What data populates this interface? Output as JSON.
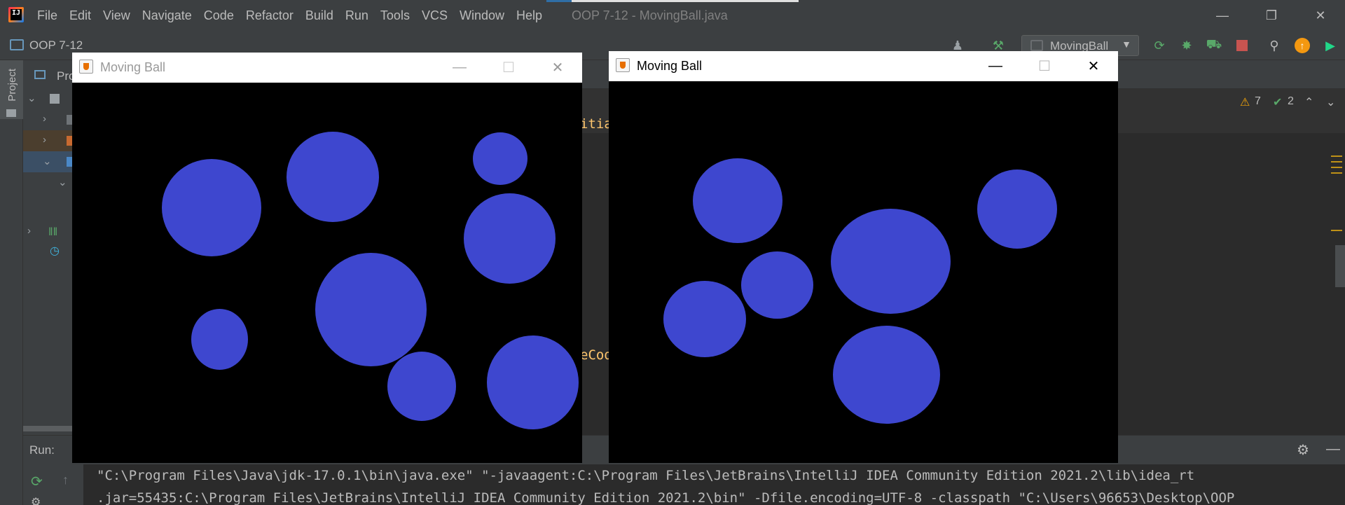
{
  "ide": {
    "menu": [
      "File",
      "Edit",
      "View",
      "Navigate",
      "Code",
      "Refactor",
      "Build",
      "Run",
      "Tools",
      "VCS",
      "Window",
      "Help"
    ],
    "window_title": "OOP 7-12 - MovingBall.java",
    "project_name": "OOP 7-12",
    "run_config": "MovingBall",
    "project_tool_tab": "Project",
    "tree_header": "Pro",
    "warnings_count": "7",
    "checks_count": "2",
    "code_fragment_1": "itia",
    "code_fragment_2": "eCod",
    "run_label": "Run:",
    "console_lines": [
      "\"C:\\Program Files\\Java\\jdk-17.0.1\\bin\\java.exe\" \"-javaagent:C:\\Program Files\\JetBrains\\IntelliJ IDEA Community Edition 2021.2\\lib\\idea_rt",
      ".jar=55435:C:\\Program Files\\JetBrains\\IntelliJ IDEA Community Edition 2021.2\\bin\" -Dfile.encoding=UTF-8 -classpath \"C:\\Users\\96653\\Desktop\\OOP"
    ]
  },
  "window_left": {
    "title": "Moving Ball",
    "active": false,
    "ball_color": "#3e47cf",
    "ball_count": 8
  },
  "window_right": {
    "title": "Moving Ball",
    "active": true,
    "ball_color": "#3e47cf",
    "ball_count": 6
  },
  "colors": {
    "ide_bg": "#3c3f41",
    "editor_bg": "#2b2b2b",
    "canvas_bg": "#000000",
    "ball": "#3e47cf",
    "warning": "#f0a30a",
    "check": "#59a869"
  }
}
